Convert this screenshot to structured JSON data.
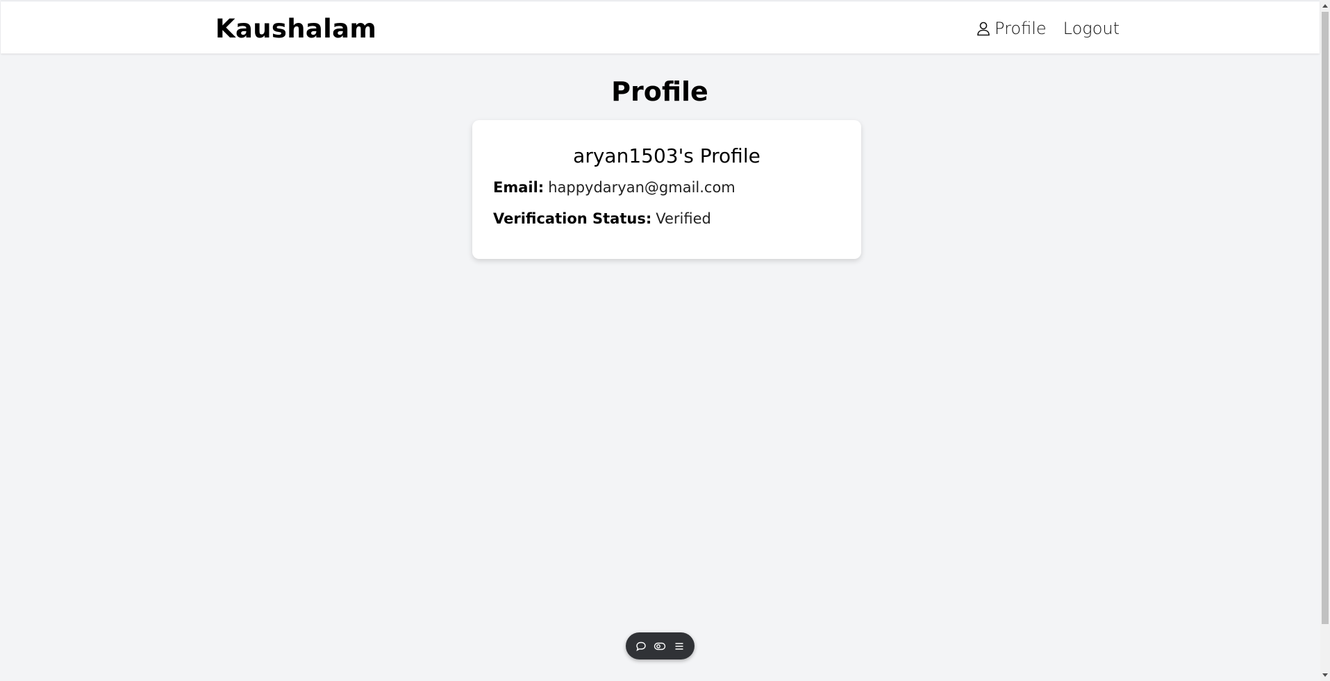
{
  "header": {
    "brand": "Kaushalam",
    "nav": {
      "profile_label": "Profile",
      "profile_icon": "user-icon",
      "logout_label": "Logout"
    }
  },
  "main": {
    "page_title": "Profile",
    "card": {
      "title": "aryan1503's Profile",
      "email_label": "Email:",
      "email_value": "happydaryan@gmail.com",
      "status_label": "Verification Status:",
      "status_value": "Verified"
    }
  },
  "floating_toolbar": {
    "icons": [
      "chat-bubble-icon",
      "eye-toggle-icon",
      "menu-icon"
    ]
  },
  "colors": {
    "page_background": "#f3f4f6",
    "card_background": "#ffffff",
    "toolbar_background": "#303236"
  }
}
